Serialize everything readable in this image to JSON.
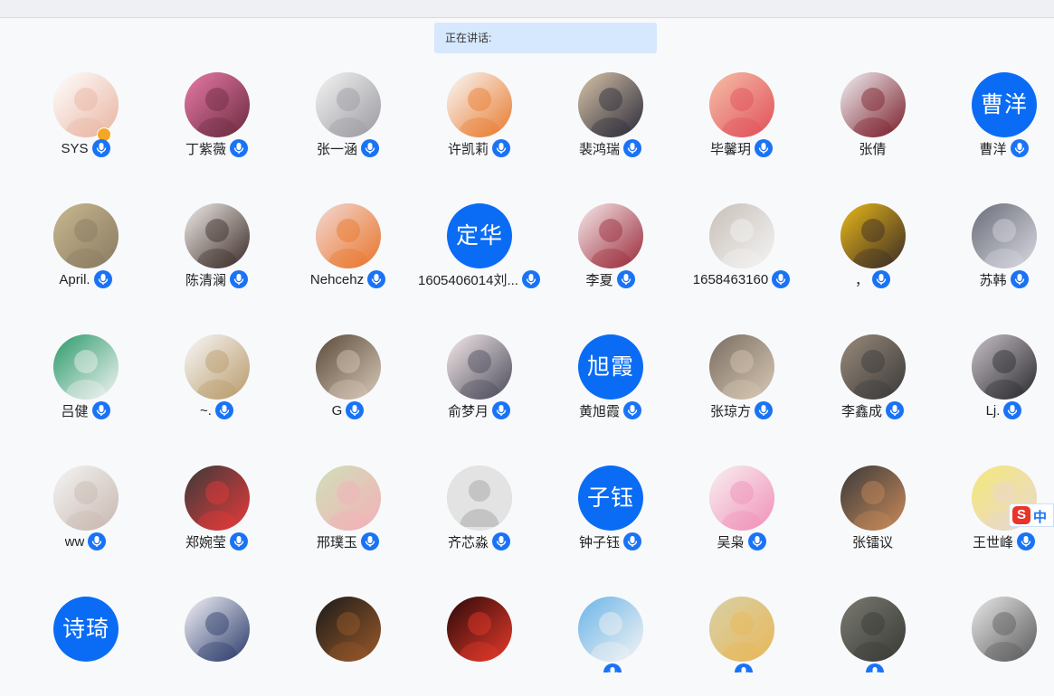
{
  "speaking_label": "正在讲话:",
  "ime": {
    "logo": "S",
    "mode": "中"
  },
  "participants": [
    {
      "name": "SYS",
      "avatar": "photo",
      "colors": [
        "#ffffff",
        "#e8b4a0"
      ],
      "mic": true,
      "host": true
    },
    {
      "name": "丁紫薇",
      "avatar": "photo",
      "colors": [
        "#e87aa8",
        "#6b2a3e"
      ],
      "mic": true
    },
    {
      "name": "张一涵",
      "avatar": "photo",
      "colors": [
        "#f4f4f4",
        "#9a9aa0"
      ],
      "mic": true
    },
    {
      "name": "许凯莉",
      "avatar": "photo",
      "colors": [
        "#f9f9f9",
        "#e87a2d"
      ],
      "mic": true
    },
    {
      "name": "裴鸿瑞",
      "avatar": "photo",
      "colors": [
        "#d8c4a8",
        "#2a2a3a"
      ],
      "mic": true
    },
    {
      "name": "毕馨玥",
      "avatar": "photo",
      "colors": [
        "#f6c0a8",
        "#e0505a"
      ],
      "mic": true
    },
    {
      "name": "张倩",
      "avatar": "photo",
      "colors": [
        "#f2f2f5",
        "#7a1e2a"
      ],
      "mic": false
    },
    {
      "name": "曹洋",
      "avatar": "text",
      "text": "曹洋",
      "mic": true
    },
    {
      "name": "April.",
      "avatar": "photo",
      "colors": [
        "#c8b890",
        "#8a7a62"
      ],
      "mic": true
    },
    {
      "name": "陈清澜",
      "avatar": "photo",
      "colors": [
        "#f0ece8",
        "#3a2a26"
      ],
      "mic": true
    },
    {
      "name": "Nehcehz",
      "avatar": "photo",
      "colors": [
        "#f3d8d4",
        "#e8762a"
      ],
      "mic": true
    },
    {
      "name": "1605406014刘...",
      "avatar": "text",
      "text": "定华",
      "mic": true
    },
    {
      "name": "李夏",
      "avatar": "photo",
      "colors": [
        "#f6eaea",
        "#9a2a3a"
      ],
      "mic": true
    },
    {
      "name": "1658463160",
      "avatar": "photo",
      "colors": [
        "#c8c0b8",
        "#f4f4f4"
      ],
      "mic": true
    },
    {
      "name": "，",
      "avatar": "photo",
      "colors": [
        "#e8b818",
        "#3a2a26"
      ],
      "mic": true
    },
    {
      "name": "苏韩",
      "avatar": "photo",
      "colors": [
        "#6a6e7a",
        "#d8d8e0"
      ],
      "mic": true
    },
    {
      "name": "吕健",
      "avatar": "photo",
      "colors": [
        "#2a9a6a",
        "#f4f4f4"
      ],
      "mic": true
    },
    {
      "name": "~.",
      "avatar": "photo",
      "colors": [
        "#f8f8f8",
        "#b89a6a"
      ],
      "mic": true
    },
    {
      "name": "G",
      "avatar": "photo",
      "colors": [
        "#5a4a3a",
        "#d8c8b8"
      ],
      "mic": true
    },
    {
      "name": "俞梦月",
      "avatar": "photo",
      "colors": [
        "#f6eaea",
        "#4a4a5a"
      ],
      "mic": true
    },
    {
      "name": "黄旭霞",
      "avatar": "text",
      "text": "旭霞",
      "mic": true
    },
    {
      "name": "张琼方",
      "avatar": "photo",
      "colors": [
        "#7a6e62",
        "#d8c8b4"
      ],
      "mic": true
    },
    {
      "name": "李鑫成",
      "avatar": "photo",
      "colors": [
        "#9a8a7a",
        "#3a3a3a"
      ],
      "mic": true
    },
    {
      "name": "Lj.",
      "avatar": "photo",
      "colors": [
        "#c8c0c8",
        "#2a2a2e"
      ],
      "mic": true
    },
    {
      "name": "ww",
      "avatar": "photo",
      "colors": [
        "#f4f4f4",
        "#c8b8b0"
      ],
      "mic": true
    },
    {
      "name": "郑婉莹",
      "avatar": "photo",
      "colors": [
        "#3a3a3a",
        "#e83a3a"
      ],
      "mic": true
    },
    {
      "name": "邢璞玉",
      "avatar": "photo",
      "colors": [
        "#cfe0b8",
        "#f4b0b8"
      ],
      "mic": true
    },
    {
      "name": "齐芯淼",
      "avatar": "default",
      "mic": true
    },
    {
      "name": "钟子钰",
      "avatar": "text",
      "text": "子钰",
      "mic": true
    },
    {
      "name": "吴枭",
      "avatar": "photo",
      "colors": [
        "#f8f0f0",
        "#f090b8"
      ],
      "mic": true
    },
    {
      "name": "张镭议",
      "avatar": "photo",
      "colors": [
        "#3a3a3a",
        "#c88a5a"
      ],
      "mic": false
    },
    {
      "name": "王世峰",
      "avatar": "photo",
      "colors": [
        "#f4e878",
        "#e8d8d0"
      ],
      "mic": true
    },
    {
      "name": "",
      "avatar": "text",
      "text": "诗琦",
      "mic": false
    },
    {
      "name": "",
      "avatar": "photo",
      "colors": [
        "#f4f4f8",
        "#2a3a6a"
      ],
      "mic": false
    },
    {
      "name": "",
      "avatar": "photo",
      "colors": [
        "#1a1a1a",
        "#9a5a2a"
      ],
      "mic": false
    },
    {
      "name": "",
      "avatar": "photo",
      "colors": [
        "#2a0a0a",
        "#e83a2a"
      ],
      "mic": false
    },
    {
      "name": "",
      "avatar": "photo",
      "colors": [
        "#6ab4e8",
        "#f4f4f4"
      ],
      "mic": true
    },
    {
      "name": "",
      "avatar": "photo",
      "colors": [
        "#d8d0a8",
        "#e8b858"
      ],
      "mic": true
    },
    {
      "name": "",
      "avatar": "photo",
      "colors": [
        "#7a7a72",
        "#3a3a36"
      ],
      "mic": true
    },
    {
      "name": "",
      "avatar": "photo",
      "colors": [
        "#e8e8e8",
        "#5a5a5a"
      ],
      "mic": false
    }
  ]
}
